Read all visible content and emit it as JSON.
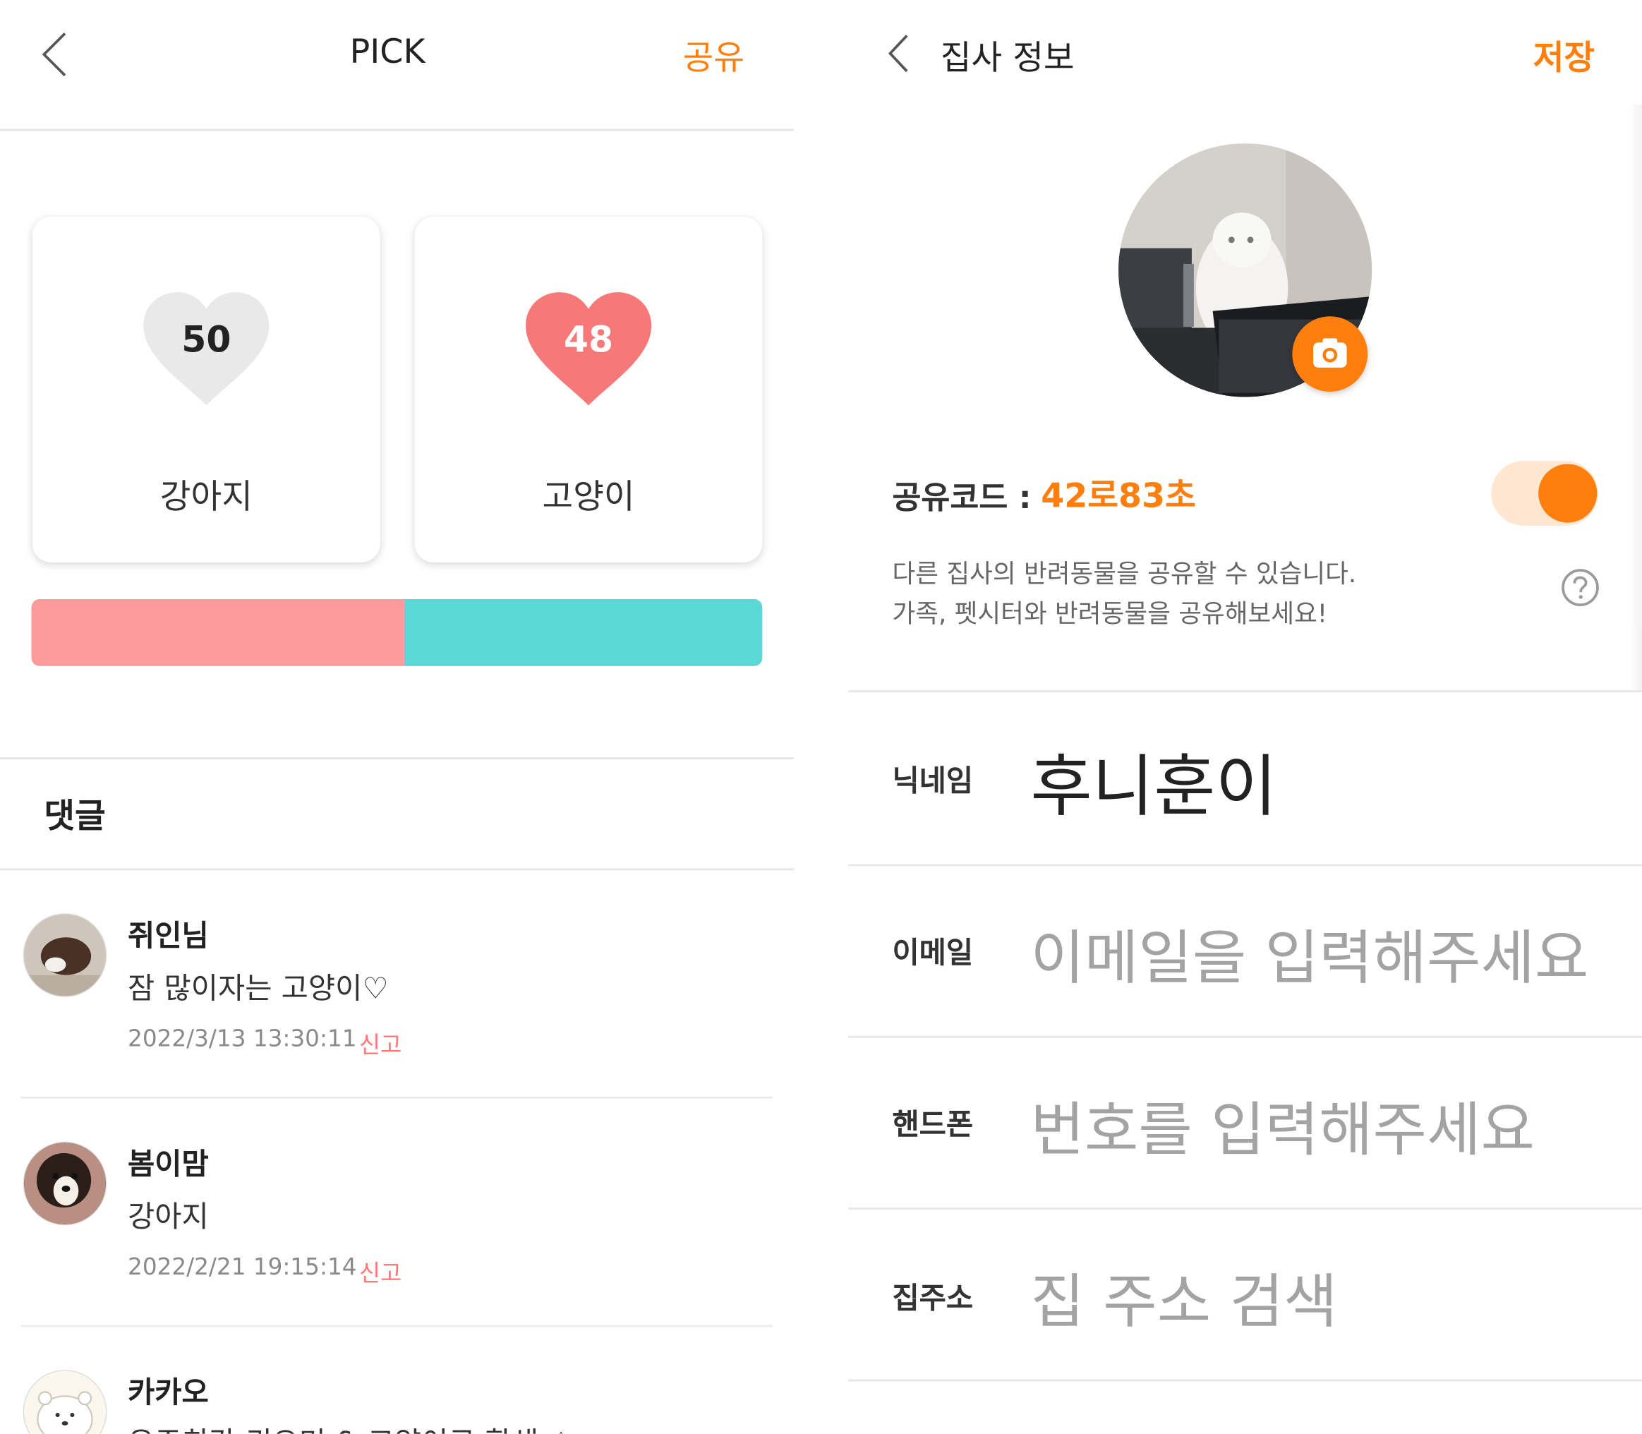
{
  "left": {
    "header": {
      "title": "PICK",
      "share_label": "공유"
    },
    "cards": [
      {
        "count": "50",
        "label": "강아지",
        "heart_color": "#e9e9e9",
        "count_color": "#222222"
      },
      {
        "count": "48",
        "label": "고양이",
        "heart_color": "#f77878",
        "count_color": "#ffffff"
      }
    ],
    "ratio": {
      "dog_fraction": 0.51,
      "dog_color": "#fd9a9a",
      "cat_color": "#5bd9d6"
    },
    "comments_title": "댓글",
    "comments": [
      {
        "name": "쥐인님",
        "text": "잠 많이자는 고양이♡",
        "date": "2022/3/13 13:30:11",
        "report": "신고"
      },
      {
        "name": "봄이맘",
        "text": "강아지",
        "date": "2022/2/21 19:15:14",
        "report": "신고"
      },
      {
        "name": "카카오",
        "text": "우주최강 귀요미 & 고양이로 환생 ♤",
        "date": "",
        "report": ""
      }
    ]
  },
  "right": {
    "header": {
      "title": "집사 정보",
      "save_label": "저장"
    },
    "share_code": {
      "label": "공유코드 :",
      "code": "42로83초",
      "toggle_on": true
    },
    "description": {
      "line1": "다른 집사의 반려동물을 공유할 수 있습니다.",
      "line2": "가족, 펫시터와 반려동물을 공유해보세요!"
    },
    "fields": {
      "nickname": {
        "label": "닉네임",
        "value": "후니훈이"
      },
      "email": {
        "label": "이메일",
        "placeholder": "이메일을 입력해주세요"
      },
      "phone": {
        "label": "핸드폰",
        "placeholder": "번호를 입력해주세요"
      },
      "address": {
        "label": "집주소",
        "placeholder": "집 주소 검색"
      }
    },
    "accent_color": "#ff7f0e"
  }
}
